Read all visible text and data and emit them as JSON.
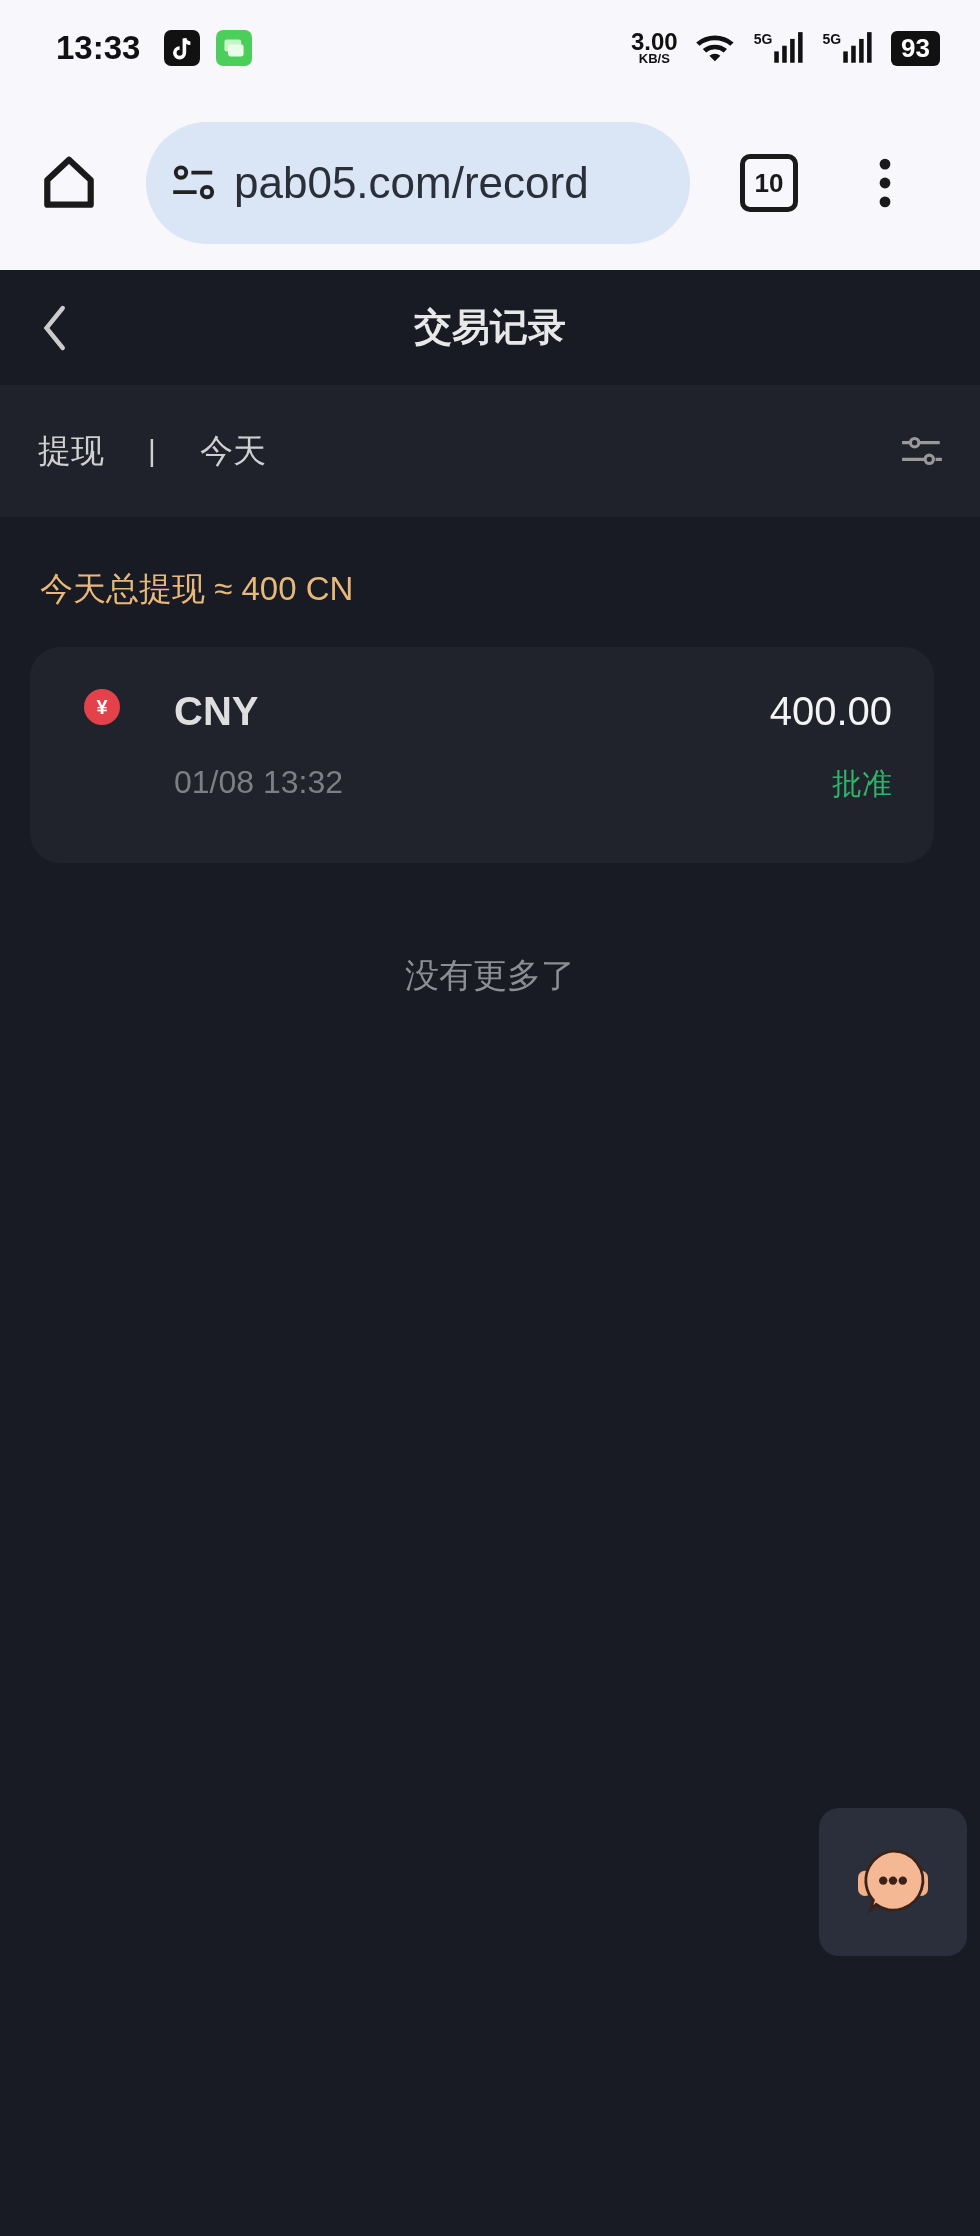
{
  "status_bar": {
    "time": "13:33",
    "speed_value": "3.00",
    "speed_unit": "KB/S",
    "sim1": "5G",
    "sim2": "5G",
    "battery": "93"
  },
  "browser": {
    "url": "pab05.com/record",
    "tab_count": "10"
  },
  "header": {
    "title": "交易记录"
  },
  "filter": {
    "type": "提现",
    "separator": "|",
    "period": "今天"
  },
  "summary": "今天总提现 ≈ 400 CN",
  "records": [
    {
      "currency_symbol": "¥",
      "currency": "CNY",
      "amount": "400.00",
      "time": "01/08 13:32",
      "status": "批准",
      "approved": true
    }
  ],
  "end_note": "没有更多了"
}
